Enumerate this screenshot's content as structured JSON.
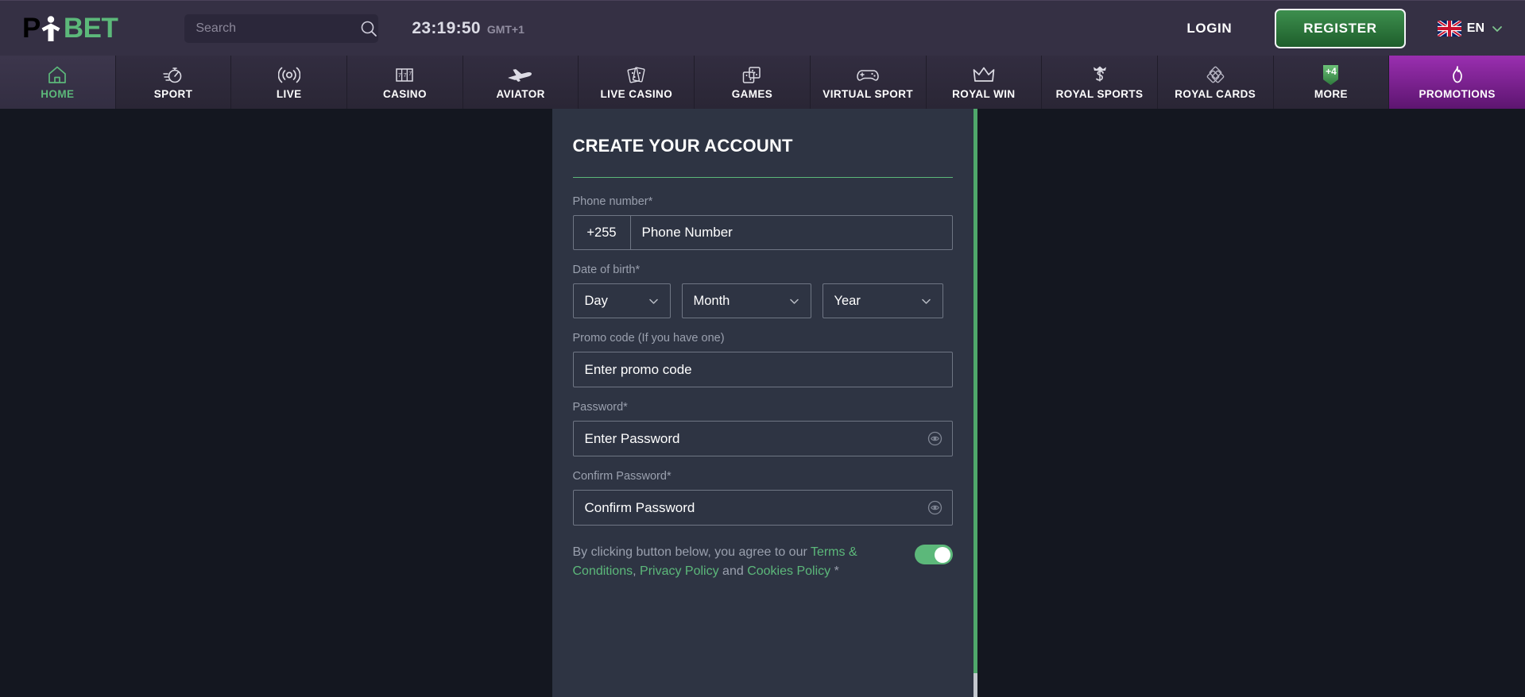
{
  "brand": {
    "name_prefix": "P",
    "name_suffix": "BET",
    "logo_icon": "pmbet-person-logo"
  },
  "header": {
    "search": {
      "placeholder": "Search",
      "value": "",
      "icon": "search-icon"
    },
    "clock": {
      "time": "23:19:50",
      "timezone": "GMT+1"
    },
    "login_label": "LOGIN",
    "register_label": "REGISTER",
    "language": {
      "code": "EN",
      "flag": "uk-flag-icon",
      "chevron": "chevron-down-icon"
    }
  },
  "nav": {
    "items": [
      {
        "label": "HOME",
        "icon": "home-icon",
        "active": true,
        "badge": null
      },
      {
        "label": "SPORT",
        "icon": "stopwatch-icon",
        "active": false,
        "badge": null
      },
      {
        "label": "LIVE",
        "icon": "broadcast-icon",
        "active": false,
        "badge": null
      },
      {
        "label": "CASINO",
        "icon": "slot-machine-icon",
        "active": false,
        "badge": null
      },
      {
        "label": "AVIATOR",
        "icon": "airplane-icon",
        "active": false,
        "badge": null
      },
      {
        "label": "LIVE CASINO",
        "icon": "playing-cards-icon",
        "active": false,
        "badge": null
      },
      {
        "label": "GAMES",
        "icon": "dice-icon",
        "active": false,
        "badge": null
      },
      {
        "label": "VIRTUAL SPORT",
        "icon": "gamepad-icon",
        "active": false,
        "badge": null
      },
      {
        "label": "ROYAL WIN",
        "icon": "crown-icon",
        "active": false,
        "badge": null
      },
      {
        "label": "ROYAL SPORTS",
        "icon": "crowned-s-icon",
        "active": false,
        "badge": null
      },
      {
        "label": "ROYAL CARDS",
        "icon": "stacked-cards-icon",
        "active": false,
        "badge": null
      },
      {
        "label": "MORE",
        "icon": "ribbon-badge-icon",
        "active": false,
        "badge": "+4"
      },
      {
        "label": "PROMOTIONS",
        "icon": "flame-icon",
        "active": false,
        "badge": null
      }
    ]
  },
  "form": {
    "title": "CREATE YOUR ACCOUNT",
    "phone": {
      "label": "Phone number*",
      "country_code": "+255",
      "placeholder": "Phone Number",
      "value": ""
    },
    "dob": {
      "label": "Date of birth*",
      "day": {
        "selected": "Day",
        "chevron": "chevron-down-icon"
      },
      "month": {
        "selected": "Month",
        "chevron": "chevron-down-icon"
      },
      "year": {
        "selected": "Year",
        "chevron": "chevron-down-icon"
      }
    },
    "promo": {
      "label": "Promo code (If you have one)",
      "placeholder": "Enter promo code",
      "value": ""
    },
    "password": {
      "label": "Password*",
      "placeholder": "Enter Password",
      "value": "",
      "toggle_icon": "eye-icon"
    },
    "confirm_password": {
      "label": "Confirm Password*",
      "placeholder": "Confirm Password",
      "value": "",
      "toggle_icon": "eye-icon"
    },
    "terms": {
      "intro": "By clicking button below, you agree to our",
      "link_terms": "Terms & Conditions",
      "separator": ",",
      "link_privacy": "Privacy Policy",
      "conjunction": "and",
      "link_cookies": "Cookies Policy",
      "required_mark": "*",
      "accepted": true
    }
  },
  "colors": {
    "accent_green": "#5cb87a",
    "header_bg": "#353044",
    "nav_bg": "#2a2636",
    "page_bg": "#141720",
    "card_bg": "#2e3443",
    "promo_purple": "#9a2fb0"
  }
}
